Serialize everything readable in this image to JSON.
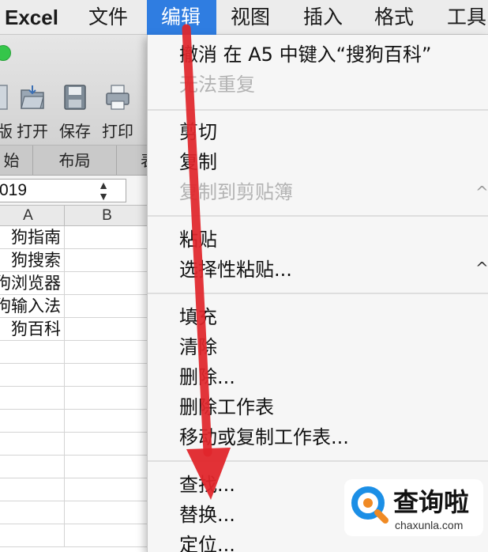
{
  "menubar": {
    "app": "Excel",
    "items": [
      "文件",
      "编辑",
      "视图",
      "插入",
      "格式",
      "工具"
    ],
    "active": "编辑"
  },
  "toolbar": {
    "buttons": [
      {
        "label": "版",
        "icon": "template-icon"
      },
      {
        "label": "打开",
        "icon": "open-folder-icon"
      },
      {
        "label": "保存",
        "icon": "save-disk-icon"
      },
      {
        "label": "打印",
        "icon": "printer-icon"
      }
    ]
  },
  "ribbon": {
    "tabs": [
      "始",
      "布局",
      "表"
    ]
  },
  "formula": {
    "namebox_value": "019",
    "stepper": "▲▼"
  },
  "grid": {
    "columns": [
      "A",
      "B"
    ],
    "rows": [
      "狗指南",
      "狗搜索",
      "狗浏览器",
      "狗输入法",
      "狗百科"
    ]
  },
  "edit_menu": {
    "groups": [
      [
        {
          "label": "撤消 在 A5 中键入“搜狗百科”",
          "disabled": false
        },
        {
          "label": "无法重复",
          "disabled": true
        }
      ],
      [
        {
          "label": "剪切",
          "disabled": false
        },
        {
          "label": "复制",
          "disabled": false
        },
        {
          "label": "复制到剪贴簿",
          "disabled": true
        }
      ],
      [
        {
          "label": "粘贴",
          "disabled": false
        },
        {
          "label": "选择性粘贴...",
          "disabled": false
        }
      ],
      [
        {
          "label": "填充",
          "disabled": false
        },
        {
          "label": "清除",
          "disabled": false
        },
        {
          "label": "删除...",
          "disabled": false
        },
        {
          "label": "删除工作表",
          "disabled": false
        },
        {
          "label": "移动或复制工作表...",
          "disabled": false
        }
      ],
      [
        {
          "label": "查找...",
          "disabled": false
        },
        {
          "label": "替换...",
          "disabled": false
        },
        {
          "label": "定位...",
          "disabled": false
        }
      ]
    ]
  },
  "logo": {
    "main": "查询啦",
    "sub": "chaxunla.com"
  },
  "colors": {
    "menu_highlight": "#2f7de1",
    "arrow": "#e0262b",
    "logo_blue": "#1c8fe6",
    "logo_orange": "#f08a24"
  }
}
